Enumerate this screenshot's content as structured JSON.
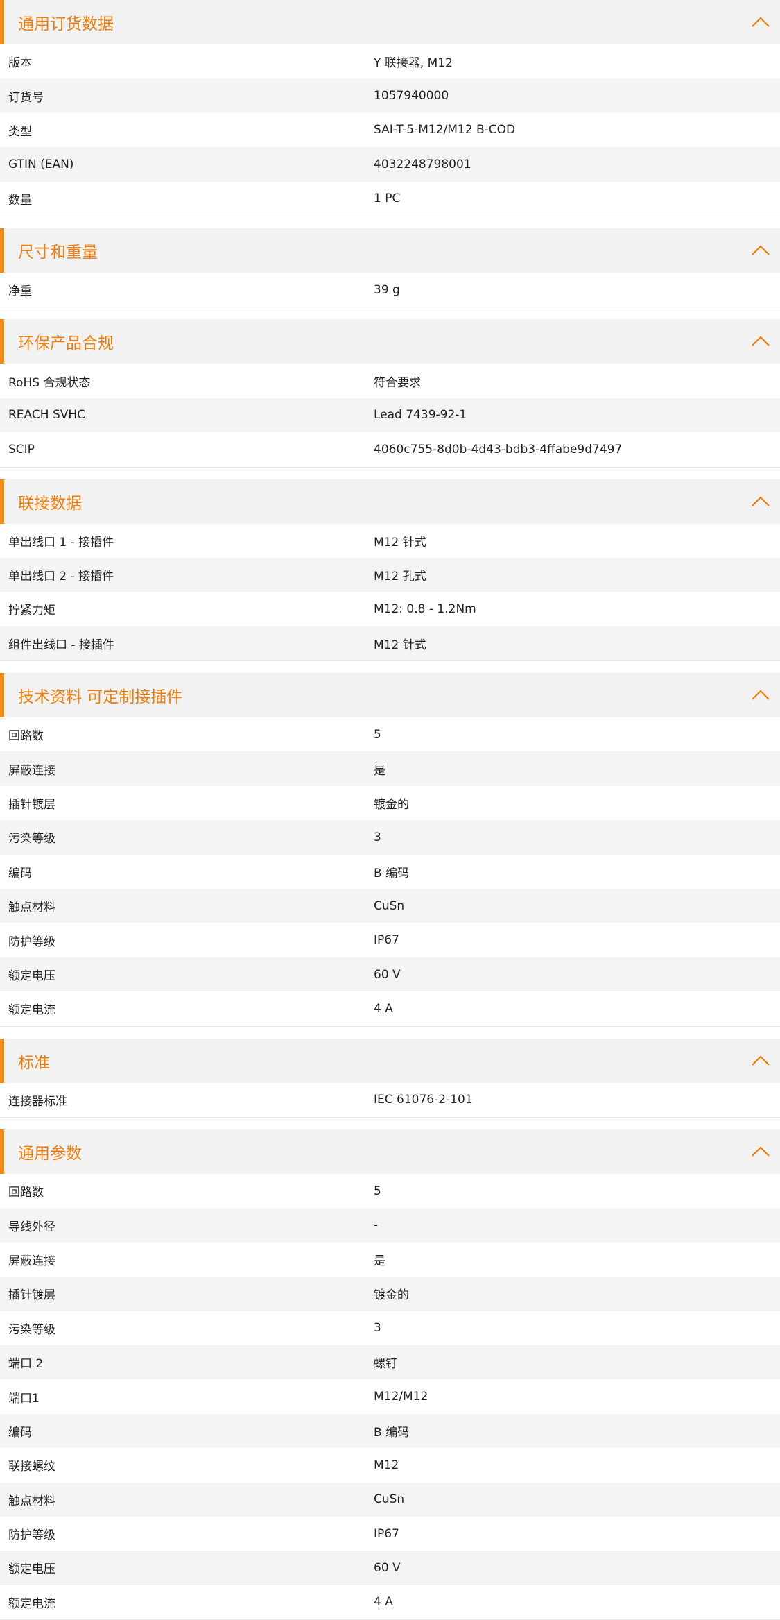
{
  "colors": {
    "accent": "#ef7d0b",
    "header_bg": "#f2f2f2",
    "stripe_bg": "#f4f4f4"
  },
  "icons": {
    "section_toggle": "chevron-up-icon"
  },
  "sections": [
    {
      "id": "ordering",
      "title": "通用订货数据",
      "rows": [
        {
          "label": "版本",
          "value": "Y 联接器, M12"
        },
        {
          "label": "订货号",
          "value": "1057940000"
        },
        {
          "label": "类型",
          "value": "SAI-T-5-M12/M12 B-COD"
        },
        {
          "label": "GTIN (EAN)",
          "value": "4032248798001"
        },
        {
          "label": "数量",
          "value": "1  PC"
        }
      ]
    },
    {
      "id": "dimensions",
      "title": "尺寸和重量",
      "rows": [
        {
          "label": "净重",
          "value": "39  g"
        }
      ]
    },
    {
      "id": "compliance",
      "title": "环保产品合规",
      "rows": [
        {
          "label": "RoHS 合规状态",
          "value": "符合要求"
        },
        {
          "label": "REACH SVHC",
          "value": "Lead 7439-92-1"
        },
        {
          "label": "SCIP",
          "value": "4060c755-8d0b-4d43-bdb3-4ffabe9d7497"
        }
      ]
    },
    {
      "id": "connection",
      "title": "联接数据",
      "rows": [
        {
          "label": "单出线口 1 - 接插件",
          "value": "M12 针式"
        },
        {
          "label": "单出线口 2 - 接插件",
          "value": "M12 孔式"
        },
        {
          "label": "拧紧力矩",
          "value": "M12: 0.8 - 1.2Nm"
        },
        {
          "label": "组件出线口 - 接插件",
          "value": "M12 针式"
        }
      ]
    },
    {
      "id": "technical",
      "title": "技术资料 可定制接插件",
      "rows": [
        {
          "label": "回路数",
          "value": "5"
        },
        {
          "label": "屏蔽连接",
          "value": "是"
        },
        {
          "label": "插针镀层",
          "value": "镀金的"
        },
        {
          "label": "污染等级",
          "value": "3"
        },
        {
          "label": "编码",
          "value": "B 编码"
        },
        {
          "label": "触点材料",
          "value": "CuSn"
        },
        {
          "label": "防护等级",
          "value": "IP67"
        },
        {
          "label": "额定电压",
          "value": "60  V"
        },
        {
          "label": "额定电流",
          "value": "4  A"
        }
      ]
    },
    {
      "id": "standards",
      "title": "标准",
      "rows": [
        {
          "label": "连接器标准",
          "value": "IEC 61076-2-101"
        }
      ]
    },
    {
      "id": "general",
      "title": "通用参数",
      "rows": [
        {
          "label": "回路数",
          "value": "5"
        },
        {
          "label": "导线外径",
          "value": "-"
        },
        {
          "label": "屏蔽连接",
          "value": "是"
        },
        {
          "label": "插针镀层",
          "value": "镀金的"
        },
        {
          "label": "污染等级",
          "value": "3"
        },
        {
          "label": "端口 2",
          "value": "螺钉"
        },
        {
          "label": "端口1",
          "value": "M12/M12"
        },
        {
          "label": "编码",
          "value": "B 编码"
        },
        {
          "label": "联接螺纹",
          "value": "M12"
        },
        {
          "label": "触点材料",
          "value": "CuSn"
        },
        {
          "label": "防护等级",
          "value": "IP67"
        },
        {
          "label": "额定电压",
          "value": "60  V"
        },
        {
          "label": "额定电流",
          "value": "4  A"
        }
      ]
    }
  ]
}
